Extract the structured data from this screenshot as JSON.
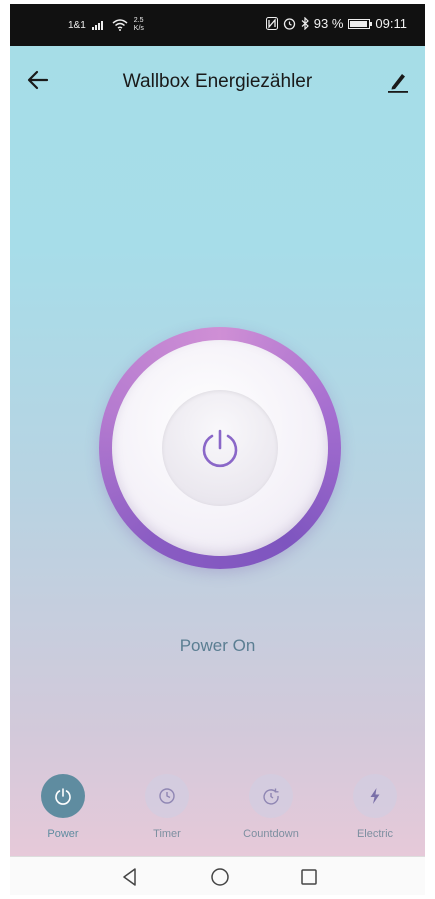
{
  "status_bar": {
    "carrier": "1&1",
    "speed_value": "2.5",
    "speed_unit": "K/s",
    "battery": "93 %",
    "battery_level": 0.93,
    "time": "09:11"
  },
  "header": {
    "title": "Wallbox Energiezähler",
    "back_icon": "arrow-left-icon",
    "edit_icon": "pencil-icon"
  },
  "main": {
    "power_icon": "power-icon",
    "status": "Power On"
  },
  "nav": [
    {
      "label": "Power",
      "icon": "power-icon",
      "active": true
    },
    {
      "label": "Timer",
      "icon": "timer-icon",
      "active": false
    },
    {
      "label": "Countdown",
      "icon": "countdown-icon",
      "active": false
    },
    {
      "label": "Electric",
      "icon": "lightning-icon",
      "active": false
    }
  ],
  "colors": {
    "accent": "#5f8ca0",
    "ring_light": "#cf8fd5",
    "ring_dark": "#7e55bf",
    "background_top": "#a6dde7",
    "background_bottom": "#e6c9d9"
  }
}
